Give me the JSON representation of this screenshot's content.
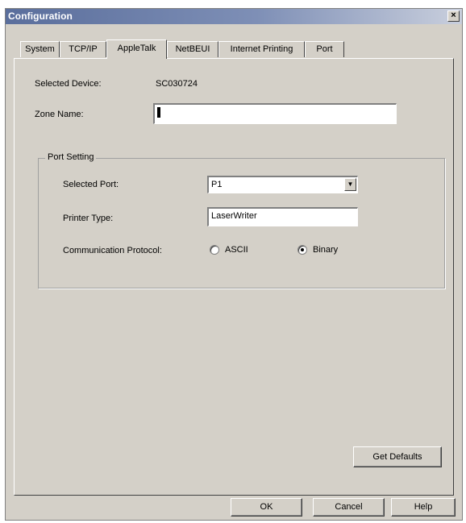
{
  "window": {
    "title": "Configuration",
    "close_glyph": "×"
  },
  "tabs": [
    {
      "label": "System"
    },
    {
      "label": "TCP/IP"
    },
    {
      "label": "AppleTalk",
      "active": true
    },
    {
      "label": "NetBEUI"
    },
    {
      "label": "Internet Printing"
    },
    {
      "label": "Port"
    }
  ],
  "device": {
    "label": "Selected Device:",
    "value": "SC030724"
  },
  "zone": {
    "label": "Zone Name:",
    "value": ""
  },
  "port_setting": {
    "title": "Port Setting",
    "selected_port": {
      "label": "Selected Port:",
      "value": "P1"
    },
    "printer_type": {
      "label": "Printer Type:",
      "value": "LaserWriter"
    },
    "protocol": {
      "label": "Communication Protocol:",
      "options": [
        {
          "label": "ASCII",
          "selected": false
        },
        {
          "label": "Binary",
          "selected": true
        }
      ]
    }
  },
  "buttons": {
    "get_defaults": "Get Defaults",
    "ok": "OK",
    "cancel": "Cancel",
    "help": "Help"
  },
  "icons": {
    "dropdown_arrow": "chevron-down-icon",
    "close": "close-icon"
  }
}
